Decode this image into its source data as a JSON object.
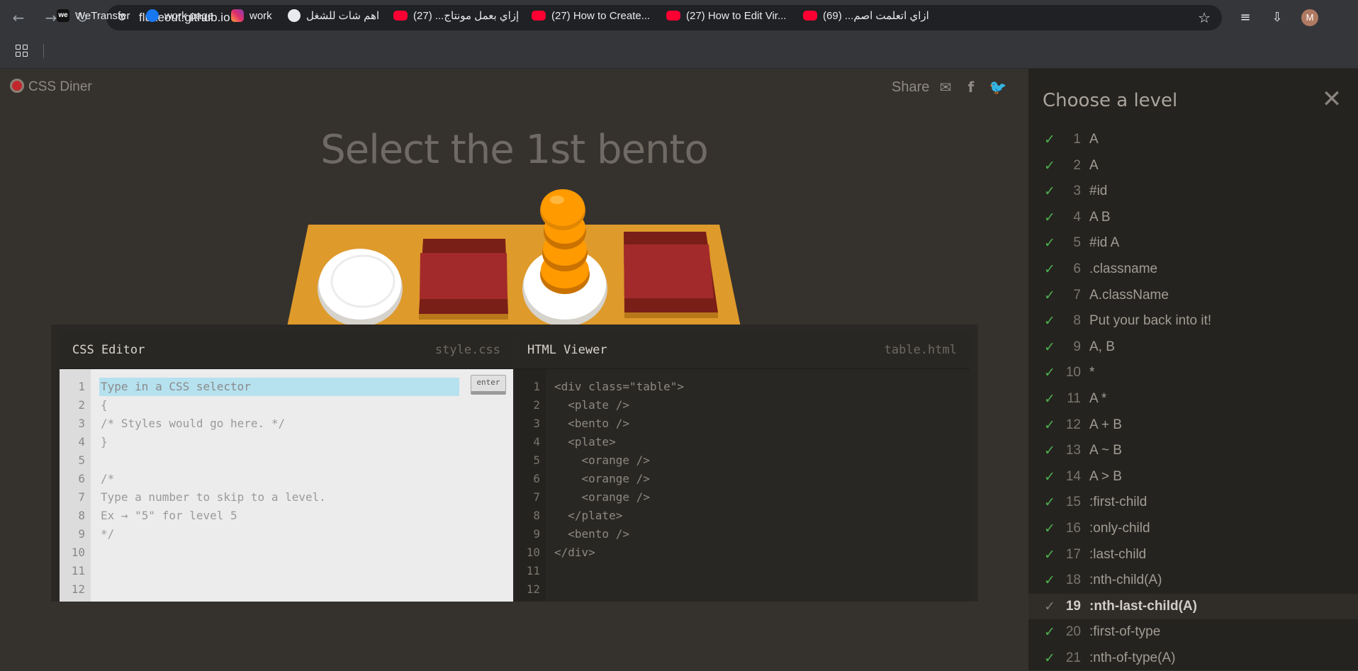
{
  "browser": {
    "url": "flukeout.github.io",
    "avatar_initial": "M",
    "bookmarks": [
      {
        "label": "WeTransfer",
        "icon": "wetransfer-icon",
        "icon_text": "we"
      },
      {
        "label": "work page",
        "icon": "facebook-icon"
      },
      {
        "label": "work",
        "icon": "instagram-icon"
      },
      {
        "label": "اهم شات للشغل",
        "icon": "chatgpt-icon"
      },
      {
        "label": "إزاي بعمل مونتاج... (27)",
        "icon": "youtube-icon"
      },
      {
        "label": "(27) How to Create...",
        "icon": "youtube-icon"
      },
      {
        "label": "(27) How to Edit Vir...",
        "icon": "youtube-icon"
      },
      {
        "label": "ازاي اتعلمت اصم... (69)",
        "icon": "youtube-icon"
      }
    ]
  },
  "game": {
    "logo": "CSS Diner",
    "share_label": "Share",
    "instruction": "Select the 1st bento"
  },
  "css_editor": {
    "title": "CSS Editor",
    "file": "style.css",
    "input_placeholder": "Type in a CSS selector",
    "enter_label": "enter",
    "line_numbers": [
      "1",
      "2",
      "3",
      "4",
      "5",
      "6",
      "7",
      "8",
      "9",
      "10",
      "11",
      "12"
    ],
    "lines": [
      "",
      "{",
      "/* Styles would go here. */",
      "}",
      "",
      "/*",
      "Type a number to skip to a level.",
      "Ex → \"5\" for level 5",
      "*/",
      "",
      "",
      ""
    ]
  },
  "html_viewer": {
    "title": "HTML Viewer",
    "file": "table.html",
    "line_numbers": [
      "1",
      "2",
      "3",
      "4",
      "5",
      "6",
      "7",
      "8",
      "9",
      "10",
      "11",
      "12"
    ],
    "lines": [
      "<div class=\"table\">",
      "  <plate />",
      "  <bento />",
      "  <plate>",
      "    <orange />",
      "    <orange />",
      "    <orange />",
      "  </plate>",
      "  <bento />",
      "</div>",
      "",
      ""
    ]
  },
  "sidebar": {
    "title": "Choose a level",
    "levels": [
      {
        "num": "1",
        "name": "A",
        "done": true
      },
      {
        "num": "2",
        "name": "A",
        "done": true
      },
      {
        "num": "3",
        "name": "#id",
        "done": true
      },
      {
        "num": "4",
        "name": "A  B",
        "done": true
      },
      {
        "num": "5",
        "name": "#id  A",
        "done": true
      },
      {
        "num": "6",
        "name": ".classname",
        "done": true
      },
      {
        "num": "7",
        "name": "A.className",
        "done": true
      },
      {
        "num": "8",
        "name": "Put your back into it!",
        "done": true
      },
      {
        "num": "9",
        "name": "A, B",
        "done": true
      },
      {
        "num": "10",
        "name": "*",
        "done": true
      },
      {
        "num": "11",
        "name": "A  *",
        "done": true
      },
      {
        "num": "12",
        "name": "A + B",
        "done": true
      },
      {
        "num": "13",
        "name": "A ~ B",
        "done": true
      },
      {
        "num": "14",
        "name": "A > B",
        "done": true
      },
      {
        "num": "15",
        "name": ":first-child",
        "done": true
      },
      {
        "num": "16",
        "name": ":only-child",
        "done": true
      },
      {
        "num": "17",
        "name": ":last-child",
        "done": true
      },
      {
        "num": "18",
        "name": ":nth-child(A)",
        "done": true
      },
      {
        "num": "19",
        "name": ":nth-last-child(A)",
        "done": false,
        "active": true
      },
      {
        "num": "20",
        "name": ":first-of-type",
        "done": false
      },
      {
        "num": "21",
        "name": ":nth-of-type(A)",
        "done": false
      }
    ]
  },
  "colors": {
    "checkmark": "#4caf50",
    "background": "#35322e",
    "sidebar_bg": "#25231f",
    "table_wood": "#de9a2b",
    "bento_red": "#a32a2a",
    "orange": "#ff9a00",
    "input_highlight": "#b6e1ef"
  }
}
